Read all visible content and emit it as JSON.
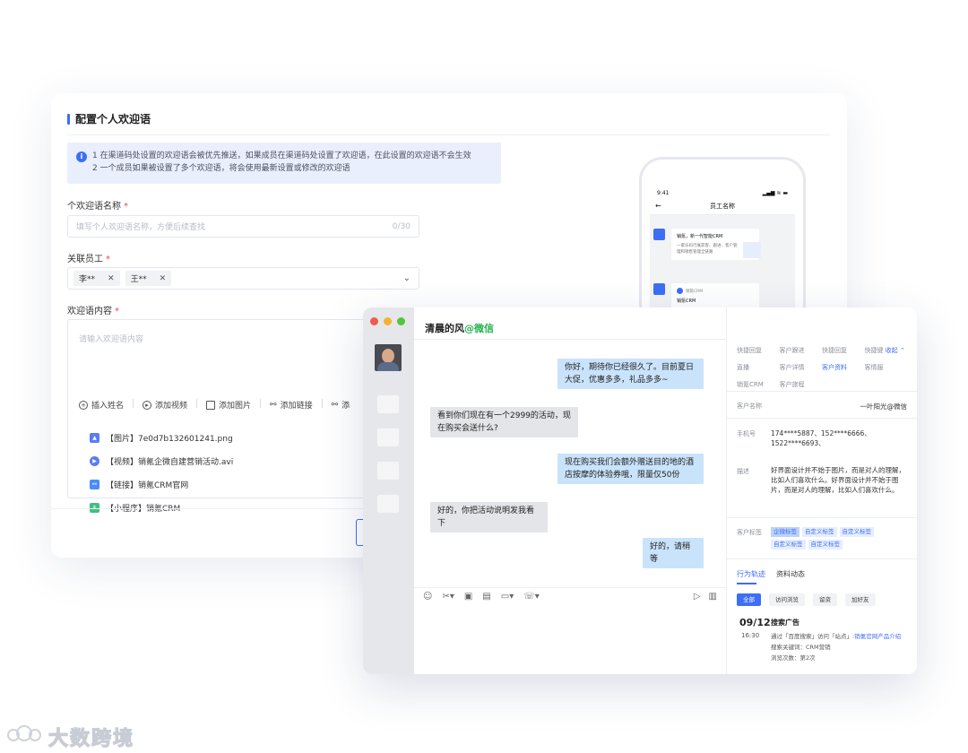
{
  "form": {
    "title": "配置个人欢迎语",
    "notice_lines": [
      "1 在渠道码处设置的欢迎语会被优先推送，如果成员在渠道码处设置了欢迎语，在此设置的欢迎语不会生效",
      "2 一个成员如果被设置了多个欢迎语，将会使用最新设置或修改的欢迎语"
    ],
    "name_label": "个欢迎语名称",
    "name_placeholder": "填写个人欢迎语名称，方便后续查找",
    "name_counter": "0/30",
    "staff_label": "关联员工",
    "staff_tags": [
      "李**",
      "王**"
    ],
    "content_label": "欢迎语内容",
    "content_placeholder": "请输入欢迎语内容",
    "toolbar": [
      "插入姓名",
      "添加视频",
      "添加图片",
      "添加链接",
      "添"
    ],
    "attachments": [
      {
        "label": "【图片】7e0d7b132601241.png",
        "color": "#5b7cf3"
      },
      {
        "label": "【视频】销氪企微自建营销活动.avi",
        "color": "#5b7cf3"
      },
      {
        "label": "【链接】销氪CRM官网",
        "color": "#4a8df8"
      },
      {
        "label": "【小程序】销氪CRM",
        "color": "#3fbf7f"
      }
    ],
    "required_mark": "*"
  },
  "phone": {
    "time": "9:41",
    "signal": "▂▄▆ ≋ ▬",
    "nav_title": "员工名称",
    "back": "←",
    "msg1_title": "销氪，新一代智能CRM",
    "msg1_sub": "一家乐码行展获客、跟进、客户管理和销售管理全链路",
    "msg2_brand": "销氪CRM",
    "msg2_title": "销氪CRM"
  },
  "chat": {
    "title_name": "清晨的风",
    "title_suffix": "@微信",
    "messages": [
      {
        "from": "me",
        "text": "你好，期待你已经很久了。目前夏日大促，优惠多多，礼品多多~"
      },
      {
        "from": "them",
        "text": "看到你们现在有一个2999的活动，现在购买会送什么?"
      },
      {
        "from": "me",
        "text": "现在购买我们会额外赠送目的地的酒店按摩的体验券哦，限量仅50份"
      },
      {
        "from": "them",
        "text": "好的，你把活动说明发我看下"
      },
      {
        "from": "me",
        "text": "好的，请稍等"
      }
    ],
    "tools_left": [
      "☺",
      "✂▾",
      "▣",
      "▤",
      "▭▾",
      "☏▾"
    ],
    "tools_right": [
      "▷",
      "▥"
    ]
  },
  "panel": {
    "quick_tabs": [
      "快捷回复",
      "客户跟进",
      "快捷回复",
      "快捷键",
      "直播",
      "客户详情",
      "客户资料",
      "客情服",
      "销氪CRM",
      "客户旅程",
      "",
      ""
    ],
    "collapse": "收起 ⌃",
    "customer_name_key": "客户名称",
    "customer_name_val": "一叶阳光@微信",
    "phone_key": "手机号",
    "phone_val": "174****5887、152****6666、1522****6693、",
    "desc_key": "描述",
    "desc_val": "好界面设计并不始于图片，而是对人的理解，比如人们喜欢什么。好界面设计并不始于图片，而是对人的理解，比如人们喜欢什么。",
    "tags_key": "客户标签",
    "tags": [
      "企微标签",
      "自定义标签",
      "自定义标签",
      "自定义标签",
      "自定义标签"
    ],
    "tab_behavior": "行为轨迹",
    "tab_profile": "资料动态",
    "chips": [
      "全部",
      "访问浏览",
      "留资",
      "加好友"
    ],
    "timeline": {
      "date": "09/12",
      "time": "16:30",
      "title": "搜索广告",
      "line1_prefix": "通过「百度搜索」访问「站点」:",
      "line1_link": "销氪官网产品介绍",
      "line2": "搜索关键词：CRM营销",
      "line3": "浏览次数：第2次"
    }
  },
  "watermark": {
    "text": "大数跨境"
  },
  "colors": {
    "accent": "#3d6ef5",
    "wechat_green": "#22b24c",
    "bubble_me": "#c9e3fb",
    "bubble_them": "#e3e5e8"
  }
}
